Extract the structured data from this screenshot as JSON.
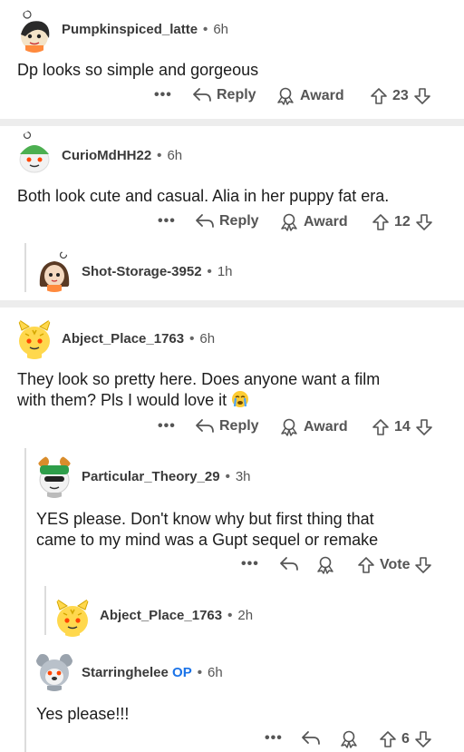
{
  "comments": [
    {
      "username": "Pumpkinspiced_latte",
      "time": "6h",
      "text": "Dp looks so simple and gorgeous",
      "reply_label": "Reply",
      "award_label": "Award",
      "votes": "23"
    },
    {
      "username": "CurioMdHH22",
      "time": "6h",
      "text": "Both look cute and casual. Alia in her puppy fat era.",
      "reply_label": "Reply",
      "award_label": "Award",
      "votes": "12"
    },
    {
      "username": "Shot-Storage-3952",
      "time": "1h"
    },
    {
      "username": "Abject_Place_1763",
      "time": "6h",
      "text_line1": "They look so pretty here. Does anyone want a film",
      "text_line2": "with them? Pls I would love it",
      "reply_label": "Reply",
      "award_label": "Award",
      "votes": "14"
    },
    {
      "username": "Particular_Theory_29",
      "time": "3h",
      "text_line1": "YES please. Don't know why but first thing that",
      "text_line2": "came to my mind was a Gupt sequel or remake",
      "vote_label": "Vote"
    },
    {
      "username": "Abject_Place_1763",
      "time": "2h"
    },
    {
      "username": "Starringhelee",
      "op_badge": "OP",
      "time": "6h",
      "text": "Yes please!!!",
      "votes": "6"
    }
  ],
  "separator": "•",
  "more_label": "•••",
  "colors": {
    "accent_blue": "#1a73e8",
    "divider": "#ededed",
    "text": "#1c1c1c",
    "meta": "#555555"
  }
}
